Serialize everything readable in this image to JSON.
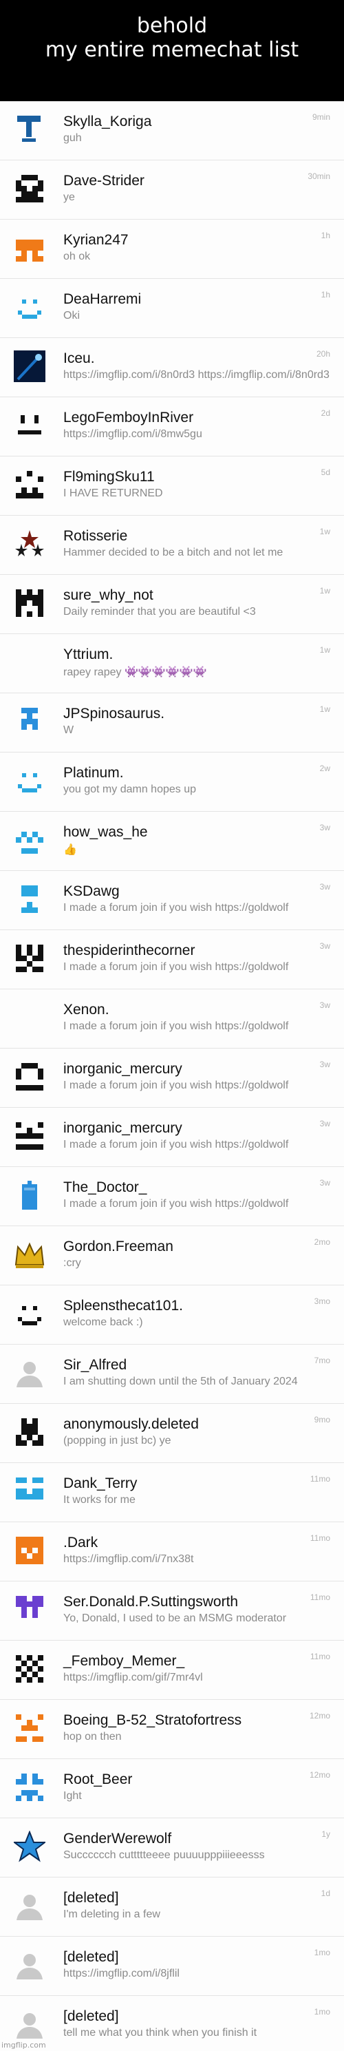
{
  "caption": "behold\nmy entire memechat list",
  "footer": "imgflip.com",
  "chats": [
    {
      "name": "Skylla_Koriga",
      "msg": "guh",
      "time": "9min",
      "icon": "hammer-icon",
      "color": "#1a5fa0"
    },
    {
      "name": "Dave-Strider",
      "msg": "ye",
      "time": "30min",
      "icon": "identicon",
      "color": "#111111"
    },
    {
      "name": "Kyrian247",
      "msg": "oh ok",
      "time": "1h",
      "icon": "identicon",
      "color": "#f07a18"
    },
    {
      "name": "DeaHarremi",
      "msg": "Oki",
      "time": "1h",
      "icon": "smile-icon",
      "color": "#2aa7e0"
    },
    {
      "name": "Iceu.",
      "msg": "https://imgflip.com/i/8n0rd3 https://imgflip.com/i/8n0rd3",
      "time": "20h",
      "icon": "comet-icon",
      "color": "#1b74c9"
    },
    {
      "name": "LegoFemboyInRiver",
      "msg": "https://imgflip.com/i/8mw5gu",
      "time": "2d",
      "icon": "face-icon",
      "color": "#111111"
    },
    {
      "name": "Fl9mingSku11",
      "msg": "I HAVE RETURNED",
      "time": "5d",
      "icon": "identicon",
      "color": "#111111"
    },
    {
      "name": "Rotisserie",
      "msg": "Hammer decided to be a bitch and not let me",
      "time": "1w",
      "icon": "stars-icon",
      "color": "#7a1d12"
    },
    {
      "name": "sure_why_not",
      "msg": "Daily reminder that you are beautiful <3",
      "time": "1w",
      "icon": "identicon",
      "color": "#111111"
    },
    {
      "name": "Yttrium.",
      "msg": "rapey rapey 👾👾👾👾👾👾",
      "time": "1w",
      "icon": "none",
      "color": "#ffffff"
    },
    {
      "name": "JPSpinosaurus.",
      "msg": "W",
      "time": "1w",
      "icon": "identicon",
      "color": "#2a8fdc"
    },
    {
      "name": "Platinum.",
      "msg": "you got my damn hopes up",
      "time": "2w",
      "icon": "smile-icon",
      "color": "#2aa7e0"
    },
    {
      "name": "how_was_he",
      "msg": "👍",
      "time": "3w",
      "icon": "identicon",
      "color": "#2aa7e0"
    },
    {
      "name": "KSDawg",
      "msg": "I made a forum join if you wish https://goldwolf",
      "time": "3w",
      "icon": "identicon",
      "color": "#2aa7e0"
    },
    {
      "name": "thespiderinthecorner",
      "msg": "I made a forum join if you wish https://goldwolf",
      "time": "3w",
      "icon": "identicon",
      "color": "#111111"
    },
    {
      "name": "Xenon.",
      "msg": "I made a forum join if you wish https://goldwolf",
      "time": "3w",
      "icon": "none",
      "color": "#ffffff"
    },
    {
      "name": "inorganic_mercury",
      "msg": "I made a forum join if you wish https://goldwolf",
      "time": "3w",
      "icon": "identicon",
      "color": "#111111"
    },
    {
      "name": "inorganic_mercury",
      "msg": "I made a forum join if you wish https://goldwolf",
      "time": "3w",
      "icon": "identicon",
      "color": "#111111"
    },
    {
      "name": "The_Doctor_",
      "msg": "I made a forum join if you wish https://goldwolf",
      "time": "3w",
      "icon": "tardis-icon",
      "color": "#2a8fdc"
    },
    {
      "name": "Gordon.Freeman",
      "msg": ":cry",
      "time": "2mo",
      "icon": "crown-icon",
      "color": "#e2b21a"
    },
    {
      "name": "Spleensthecat101.",
      "msg": "welcome back :)",
      "time": "3mo",
      "icon": "smile-icon",
      "color": "#111111"
    },
    {
      "name": "Sir_Alfred",
      "msg": "I am shutting down until the 5th of January 2024",
      "time": "7mo",
      "icon": "default-avatar-icon",
      "color": "#c9c9c9"
    },
    {
      "name": "anonymously.deleted",
      "msg": "(popping in just bc) ye",
      "time": "9mo",
      "icon": "identicon",
      "color": "#111111"
    },
    {
      "name": "Dank_Terry",
      "msg": "It works for me",
      "time": "11mo",
      "icon": "identicon",
      "color": "#2aa7e0"
    },
    {
      "name": ".Dark",
      "msg": "https://imgflip.com/i/7nx38t",
      "time": "11mo",
      "icon": "identicon",
      "color": "#f07a18"
    },
    {
      "name": "Ser.Donald.P.Suttingsworth",
      "msg": "Yo, Donald, I used to be an MSMG moderator",
      "time": "11mo",
      "icon": "identicon",
      "color": "#6a3fd0"
    },
    {
      "name": "_Femboy_Memer_",
      "msg": "https://imgflip.com/gif/7mr4vl",
      "time": "11mo",
      "icon": "checker-icon",
      "color": "#111111"
    },
    {
      "name": "Boeing_B-52_Stratofortress",
      "msg": "hop on then",
      "time": "12mo",
      "icon": "identicon",
      "color": "#f07a18"
    },
    {
      "name": "Root_Beer",
      "msg": "Ight",
      "time": "12mo",
      "icon": "identicon",
      "color": "#2a8fdc"
    },
    {
      "name": "GenderWerewolf",
      "msg": "Succcccch cuttttteeee puuuupppiiieeesss",
      "time": "1y",
      "icon": "star-icon",
      "color": "#2a8fdc"
    },
    {
      "name": "[deleted]",
      "msg": "I'm deleting in a few",
      "time": "1d",
      "icon": "default-avatar-icon",
      "color": "#c9c9c9"
    },
    {
      "name": "[deleted]",
      "msg": "https://imgflip.com/i/8jflil",
      "time": "1mo",
      "icon": "default-avatar-icon",
      "color": "#c9c9c9"
    },
    {
      "name": "[deleted]",
      "msg": "tell me what you think when you finish it",
      "time": "1mo",
      "icon": "default-avatar-icon",
      "color": "#c9c9c9"
    }
  ]
}
